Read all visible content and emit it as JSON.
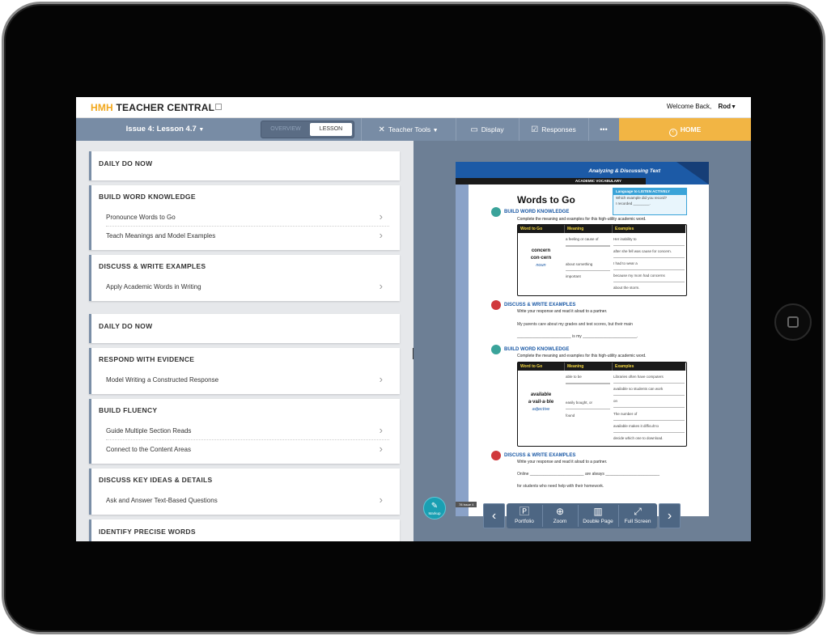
{
  "header": {
    "logo_hmh": "HMH",
    "logo_rest": " TEACHER CENTRAL",
    "welcome": "Welcome Back,",
    "user": "Rod"
  },
  "nav": {
    "issue_label": "Issue 4: Lesson 4.7",
    "toggle_overview": "OVERVIEW",
    "toggle_lesson": "LESSON",
    "teacher_tools": "Teacher Tools",
    "display": "Display",
    "responses": "Responses",
    "more": "•••",
    "home": "HOME",
    "home_color": "#f2b544"
  },
  "lesson_sections": [
    {
      "title": "DAILY DO NOW",
      "items": []
    },
    {
      "title": "BUILD WORD KNOWLEDGE",
      "items": [
        "Pronounce Words to Go",
        "Teach Meanings and Model Examples"
      ]
    },
    {
      "title": "DISCUSS & WRITE EXAMPLES",
      "items": [
        "Apply Academic Words in Writing"
      ]
    },
    {
      "title": "DAILY DO NOW",
      "items": []
    },
    {
      "title": "RESPOND WITH EVIDENCE",
      "items": [
        "Model Writing a Constructed Response"
      ]
    },
    {
      "title": "BUILD FLUENCY",
      "items": [
        "Guide Multiple Section Reads",
        "Connect to the Content Areas"
      ]
    },
    {
      "title": "DISCUSS KEY IDEAS & DETAILS",
      "items": [
        "Ask and Answer Text-Based Questions"
      ]
    },
    {
      "title": "IDENTIFY PRECISE WORDS",
      "items": []
    }
  ],
  "page": {
    "band_title": "Analyzing & Discussing Text",
    "band_sub": "ACADEMIC VOCABULARY",
    "title": "Words to Go",
    "listen_head": "Language to LISTEN ACTIVELY",
    "listen_line1": "Which example did you record?",
    "listen_line2": "I recorded ________.",
    "sec1_title": "BUILD WORD KNOWLEDGE",
    "sec1_sub": "Complete the meaning and examples for this high-utility academic word.",
    "col_word": "Word to Go",
    "col_meaning": "Meaning",
    "col_examples": "Examples",
    "word1": "concern",
    "word1_syll": "con·cern",
    "word1_pos": "noun",
    "w1_meaning": [
      "a feeling or cause of",
      "",
      "about something",
      "important"
    ],
    "w1_examples": [
      "Her inability to",
      "after she fell was cause for concern.",
      "I had to wear a",
      "because my mom had concerns",
      "about the storm."
    ],
    "sec2_title": "DISCUSS & WRITE EXAMPLES",
    "sec2_sub": "Write your response and read it aloud to a partner.",
    "sec2_line1": "My parents care about my grades and test scores, but their main",
    "sec2_line2": "________________________ is my ________________________.",
    "sec3_title": "BUILD WORD KNOWLEDGE",
    "sec3_sub": "Complete the meaning and examples for this high-utility academic word.",
    "word2": "available",
    "word2_syll": "a·vail·a·ble",
    "word2_pos": "adjective",
    "w2_meaning": [
      "able to be",
      "",
      "easily bought, or",
      "found"
    ],
    "w2_examples": [
      "Libraries often have computers",
      "available so students can work",
      "on",
      "The number of",
      "available makes it difficult to",
      "decide which one to download."
    ],
    "sec4_title": "DISCUSS & WRITE EXAMPLES",
    "sec4_sub": "Write your response and read it aloud to a partner.",
    "sec4_line1": "Online ________________________ are always ________________________",
    "sec4_line2": "for students who need help with their homework.",
    "footer": "78 Issue 4"
  },
  "toolbar": {
    "markup": "Markup",
    "portfolio": "Portfolio",
    "zoom": "Zoom",
    "double_page": "Double Page",
    "full_screen": "Full Screen",
    "prev": "‹",
    "next": "›"
  }
}
